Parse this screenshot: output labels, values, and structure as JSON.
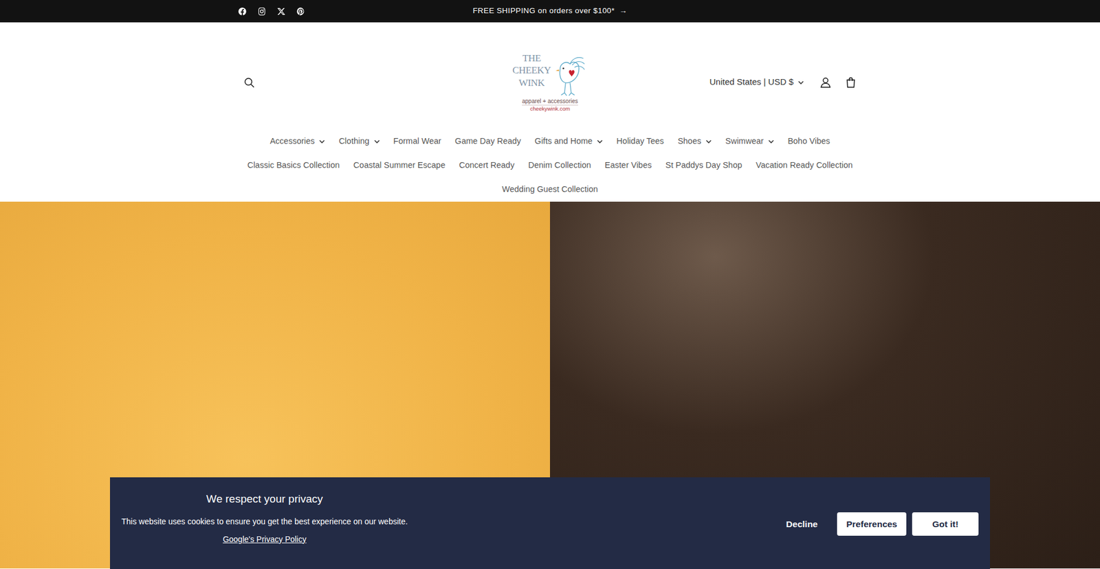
{
  "announcement": {
    "text": "FREE SHIPPING on orders over $100*",
    "arrow": "→"
  },
  "logo": {
    "lines": [
      "THE",
      "CHEEKY",
      "WINK"
    ],
    "tagline": "apparel + accessories",
    "url": "cheekywink.com"
  },
  "locale": "United States | USD $",
  "nav_rows": [
    [
      {
        "label": "Accessories",
        "dropdown": true
      },
      {
        "label": "Clothing",
        "dropdown": true
      },
      {
        "label": "Formal Wear",
        "dropdown": false
      },
      {
        "label": "Game Day Ready",
        "dropdown": false
      },
      {
        "label": "Gifts and Home",
        "dropdown": true
      },
      {
        "label": "Holiday Tees",
        "dropdown": false
      },
      {
        "label": "Shoes",
        "dropdown": true
      },
      {
        "label": "Swimwear",
        "dropdown": true
      },
      {
        "label": "Boho Vibes",
        "dropdown": false
      }
    ],
    [
      {
        "label": "Classic Basics Collection",
        "dropdown": false
      },
      {
        "label": "Coastal Summer Escape",
        "dropdown": false
      },
      {
        "label": "Concert Ready",
        "dropdown": false
      },
      {
        "label": "Denim Collection",
        "dropdown": false
      },
      {
        "label": "Easter Vibes",
        "dropdown": false
      },
      {
        "label": "St Paddys Day Shop",
        "dropdown": false
      },
      {
        "label": "Vacation Ready Collection",
        "dropdown": false
      }
    ],
    [
      {
        "label": "Wedding Guest Collection",
        "dropdown": false
      }
    ]
  ],
  "cookie_banner": {
    "title": "We respect your privacy",
    "text": "This website uses cookies to ensure you get the best experience on our website.",
    "link": "Google's Privacy Policy",
    "buttons": [
      {
        "label": "Decline",
        "kind": "link"
      },
      {
        "label": "Preferences",
        "kind": "filled"
      },
      {
        "label": "Got it!",
        "kind": "filled"
      }
    ]
  }
}
